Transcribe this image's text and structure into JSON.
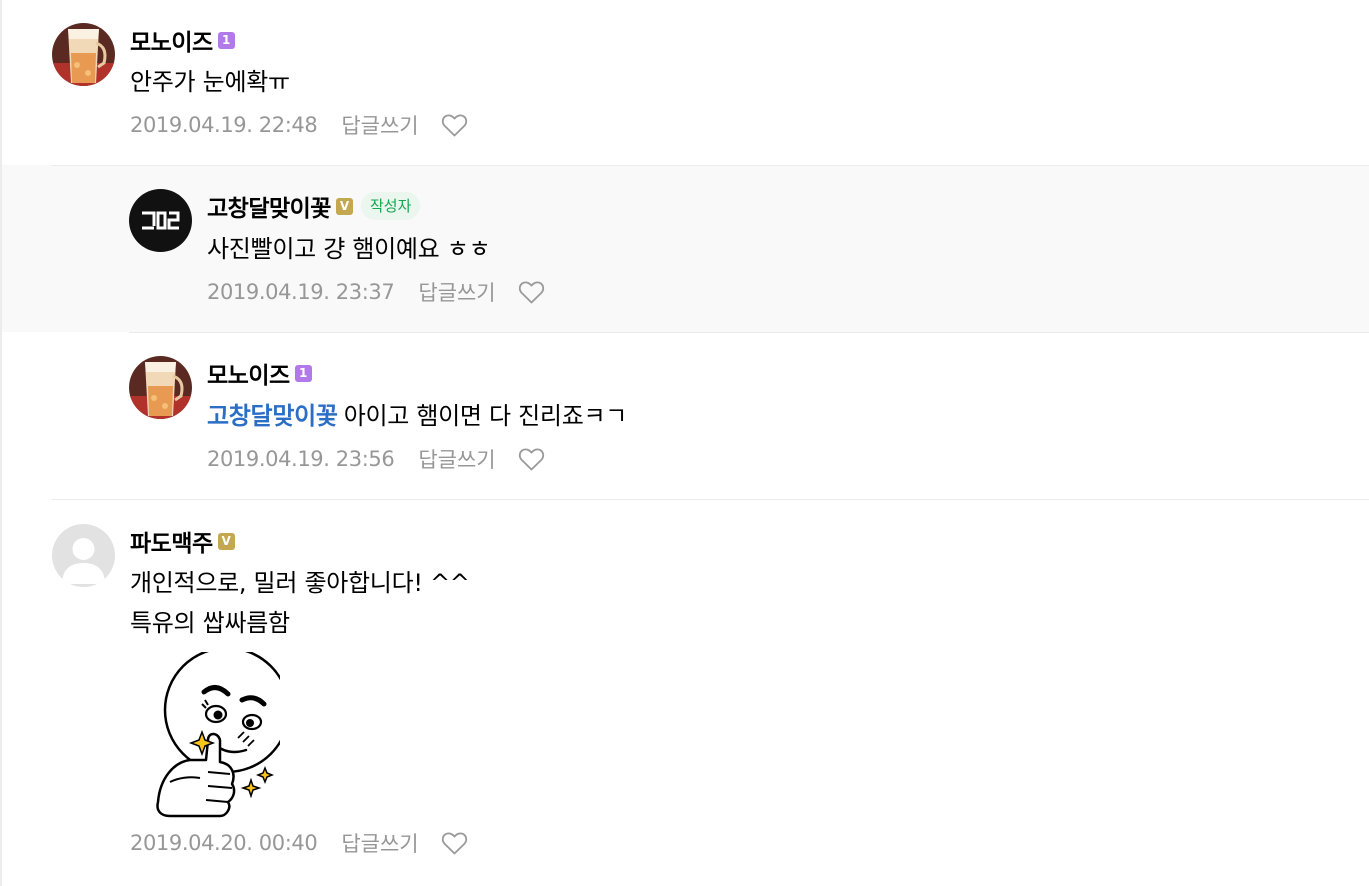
{
  "colors": {
    "level_badge": "#b279e9",
    "verified_badge": "#c4a850",
    "author_tag_text": "#14a751",
    "author_tag_bg": "#eaf6ee",
    "mention": "#2c6ec6",
    "meta_text": "#979797",
    "reply_bg": "#f9f9fa"
  },
  "comments": [
    {
      "nickname": "모노이즈",
      "badge": "1",
      "badge_icon": "level-badge-icon",
      "avatar_icon": "beer-glass-avatar",
      "text": "안주가 눈에확ㅠ",
      "date": "2019.04.19. 22:48",
      "reply_label": "답글쓰기",
      "like_icon": "heart-icon"
    },
    {
      "nickname": "고창달맞이꽃",
      "badge": "V",
      "badge_icon": "verified-badge-icon",
      "author_tag": "작성자",
      "avatar_icon": "blog-logo-avatar",
      "text": "사진빨이고 걍 햄이예요 ㅎㅎ",
      "date": "2019.04.19. 23:37",
      "reply_label": "답글쓰기",
      "like_icon": "heart-icon"
    },
    {
      "nickname": "모노이즈",
      "badge": "1",
      "badge_icon": "level-badge-icon",
      "avatar_icon": "beer-glass-avatar",
      "mention": "고창달맞이꽃",
      "text": "아이고 햄이면 다 진리죠ㅋㄱ",
      "date": "2019.04.19. 23:56",
      "reply_label": "답글쓰기",
      "like_icon": "heart-icon"
    },
    {
      "nickname": "파도맥주",
      "badge": "V",
      "badge_icon": "verified-badge-icon",
      "avatar_icon": "default-user-avatar",
      "text_line1": "개인적으로, 밀러 좋아합니다! ^^",
      "text_line2": "특유의 쌉싸름함",
      "sticker_icon": "thumbs-up-sticker",
      "date": "2019.04.20. 00:40",
      "reply_label": "답글쓰기",
      "like_icon": "heart-icon"
    }
  ]
}
